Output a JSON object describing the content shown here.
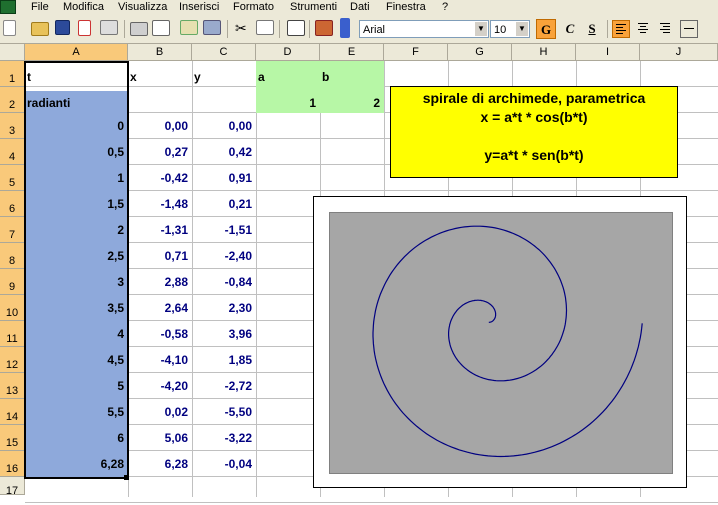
{
  "menu": [
    "File",
    "Modifica",
    "Visualizza",
    "Inserisci",
    "Formato",
    "Strumenti",
    "Dati",
    "Finestra",
    "?"
  ],
  "toolbar": {
    "font_name": "Arial",
    "font_size": "10",
    "bold_label": "G",
    "italic_label": "C",
    "underline_label": "S"
  },
  "columns": [
    "A",
    "B",
    "C",
    "D",
    "E",
    "F",
    "G",
    "H",
    "I",
    "J"
  ],
  "rows": [
    "1",
    "2",
    "3",
    "4",
    "5",
    "6",
    "7",
    "8",
    "9",
    "10",
    "11",
    "12",
    "13",
    "14",
    "15",
    "16",
    "17"
  ],
  "cells": {
    "A1": "t",
    "B1": "x",
    "C1": "y",
    "D1": "a",
    "E1": "b",
    "A2": "radianti",
    "D2": "1",
    "E2": "2"
  },
  "table": [
    {
      "t": "0",
      "x": "0,00",
      "y": "0,00"
    },
    {
      "t": "0,5",
      "x": "0,27",
      "y": "0,42"
    },
    {
      "t": "1",
      "x": "-0,42",
      "y": "0,91"
    },
    {
      "t": "1,5",
      "x": "-1,48",
      "y": "0,21"
    },
    {
      "t": "2",
      "x": "-1,31",
      "y": "-1,51"
    },
    {
      "t": "2,5",
      "x": "0,71",
      "y": "-2,40"
    },
    {
      "t": "3",
      "x": "2,88",
      "y": "-0,84"
    },
    {
      "t": "3,5",
      "x": "2,64",
      "y": "2,30"
    },
    {
      "t": "4",
      "x": "-0,58",
      "y": "3,96"
    },
    {
      "t": "4,5",
      "x": "-4,10",
      "y": "1,85"
    },
    {
      "t": "5",
      "x": "-4,20",
      "y": "-2,72"
    },
    {
      "t": "5,5",
      "x": "0,02",
      "y": "-5,50"
    },
    {
      "t": "6",
      "x": "5,06",
      "y": "-3,22"
    },
    {
      "t": "6,28",
      "x": "6,28",
      "y": "-0,04"
    }
  ],
  "textbox": {
    "line1": "spirale di archimede, parametrica",
    "line2": "x = a*t * cos(b*t)",
    "line3": "y=a*t * sen(b*t)"
  },
  "chart": {
    "type": "scatter-smooth-line",
    "line_color": "#000080",
    "plot_background": "#a6a6a6",
    "a": 1,
    "b": 2,
    "t_range": [
      0,
      6.28
    ],
    "ylim": [
      -6.2,
      4.5
    ],
    "xlim": [
      -6.5,
      7.5
    ]
  },
  "colors": {
    "selection": "#8ea9db",
    "header_selected": "#f9c97a",
    "params_fill": "#b7f7a6",
    "textbox_fill": "#ffff00",
    "data_text": "#000080"
  }
}
